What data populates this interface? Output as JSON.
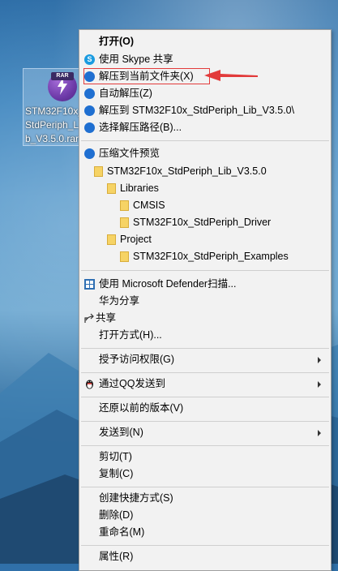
{
  "desktop": {
    "file_label_lines": [
      "STM32F10x_",
      "StdPeriph_L",
      "b_V3.5.0.rar"
    ],
    "icon_tag": "RAR"
  },
  "menu": {
    "open": "打开(O)",
    "share_skype": "使用 Skype 共享",
    "extract_here": "解压到当前文件夹(X)",
    "auto_extract": "自动解压(Z)",
    "extract_to": "解压到 STM32F10x_StdPeriph_Lib_V3.5.0\\",
    "choose_path": "选择解压路径(B)...",
    "preview": "压缩文件预览",
    "tree": [
      {
        "label": "STM32F10x_StdPeriph_Lib_V3.5.0",
        "depth": 0
      },
      {
        "label": "Libraries",
        "depth": 1
      },
      {
        "label": "CMSIS",
        "depth": 2
      },
      {
        "label": "STM32F10x_StdPeriph_Driver",
        "depth": 2
      },
      {
        "label": "Project",
        "depth": 1
      },
      {
        "label": "STM32F10x_StdPeriph_Examples",
        "depth": 2
      }
    ],
    "defender": "使用 Microsoft Defender扫描...",
    "huawei_share": "华为分享",
    "share": "共享",
    "open_with": "打开方式(H)...",
    "grant_access": "授予访问权限(G)",
    "qq_send": "通过QQ发送到",
    "restore_versions": "还原以前的版本(V)",
    "send_to": "发送到(N)",
    "cut": "剪切(T)",
    "copy": "复制(C)",
    "create_shortcut": "创建快捷方式(S)",
    "delete": "删除(D)",
    "rename": "重命名(M)",
    "properties": "属性(R)"
  },
  "colors": {
    "highlight_border": "#e23b3b",
    "bandizip_blue": "#1f6fd1"
  }
}
